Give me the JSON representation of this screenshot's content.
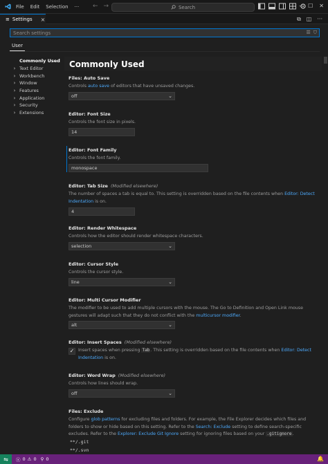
{
  "titlebar": {
    "menu": [
      "File",
      "Edit",
      "Selection",
      "···"
    ],
    "back_icon": "←",
    "forward_icon": "→",
    "search_label": "Search"
  },
  "tab": {
    "title": "Settings",
    "icon": "≡",
    "close": "×"
  },
  "search": {
    "placeholder": "Search settings",
    "value": ""
  },
  "scope": {
    "label": "User"
  },
  "toc": [
    {
      "label": "Commonly Used",
      "chevron": ""
    },
    {
      "label": "Text Editor",
      "chevron": "›"
    },
    {
      "label": "Workbench",
      "chevron": "›"
    },
    {
      "label": "Window",
      "chevron": "›"
    },
    {
      "label": "Features",
      "chevron": "›"
    },
    {
      "label": "Application",
      "chevron": "›"
    },
    {
      "label": "Security",
      "chevron": "›"
    },
    {
      "label": "Extensions",
      "chevron": "›"
    }
  ],
  "section_title": "Commonly Used",
  "settings": {
    "auto_save": {
      "title": "Files: Auto Save",
      "desc_pre": "Controls ",
      "desc_link": "auto save",
      "desc_post": " of editors that have unsaved changes.",
      "value": "off"
    },
    "font_size": {
      "title": "Editor: Font Size",
      "desc": "Controls the font size in pixels.",
      "value": "14"
    },
    "font_family": {
      "title": "Editor: Font Family",
      "desc": "Controls the font family.",
      "value": "monospace"
    },
    "tab_size": {
      "title": "Editor: Tab Size",
      "modified": "(Modified elsewhere)",
      "desc_pre": "The number of spaces a tab is equal to. This setting is overridden based on the file contents when ",
      "desc_link": "Editor: Detect Indentation",
      "desc_post": " is on.",
      "value": "4"
    },
    "render_whitespace": {
      "title": "Editor: Render Whitespace",
      "desc": "Controls how the editor should render whitespace characters.",
      "value": "selection"
    },
    "cursor_style": {
      "title": "Editor: Cursor Style",
      "desc": "Controls the cursor style.",
      "value": "line"
    },
    "multi_cursor": {
      "title": "Editor: Multi Cursor Modifier",
      "desc_pre": "The modifier to be used to add multiple cursors with the mouse. The Go to Definition and Open Link mouse gestures will adapt such that they do not conflict with the ",
      "desc_link": "multicursor modifier",
      "desc_post": ".",
      "value": "alt"
    },
    "insert_spaces": {
      "title": "Editor: Insert Spaces",
      "modified": "(Modified elsewhere)",
      "desc_pre": "Insert spaces when pressing ",
      "desc_code": "Tab",
      "desc_mid": ". This setting is overridden based on the file contents when ",
      "desc_link": "Editor: Detect Indentation",
      "desc_post": " is on.",
      "checked_mark": "✓"
    },
    "word_wrap": {
      "title": "Editor: Word Wrap",
      "modified": "(Modified elsewhere)",
      "desc": "Controls how lines should wrap.",
      "value": "off"
    },
    "files_exclude": {
      "title": "Files: Exclude",
      "desc_1": "Configure ",
      "desc_link_1": "glob patterns",
      "desc_2": " for excluding files and folders. For example, the File Explorer decides which files and folders to show or hide based on this setting. Refer to the ",
      "desc_link_2": "Search: Exclude",
      "desc_3": " setting to define search-specific excludes. Refer to the ",
      "desc_link_3": "Explorer: Exclude Git Ignore",
      "desc_4": " setting for ignoring files based on your ",
      "desc_code": ".gitignore",
      "desc_5": ".",
      "items": [
        "**/.git",
        "**/.svn"
      ]
    }
  },
  "statusbar": {
    "remote_icon": "⇋",
    "errors": "0",
    "warnings": "0",
    "ports": "0",
    "bell_icon": "🔔"
  },
  "colors": {
    "accent": "#0078d4",
    "link": "#4daafc",
    "statusbar": "#68217a",
    "remote": "#16825d"
  }
}
